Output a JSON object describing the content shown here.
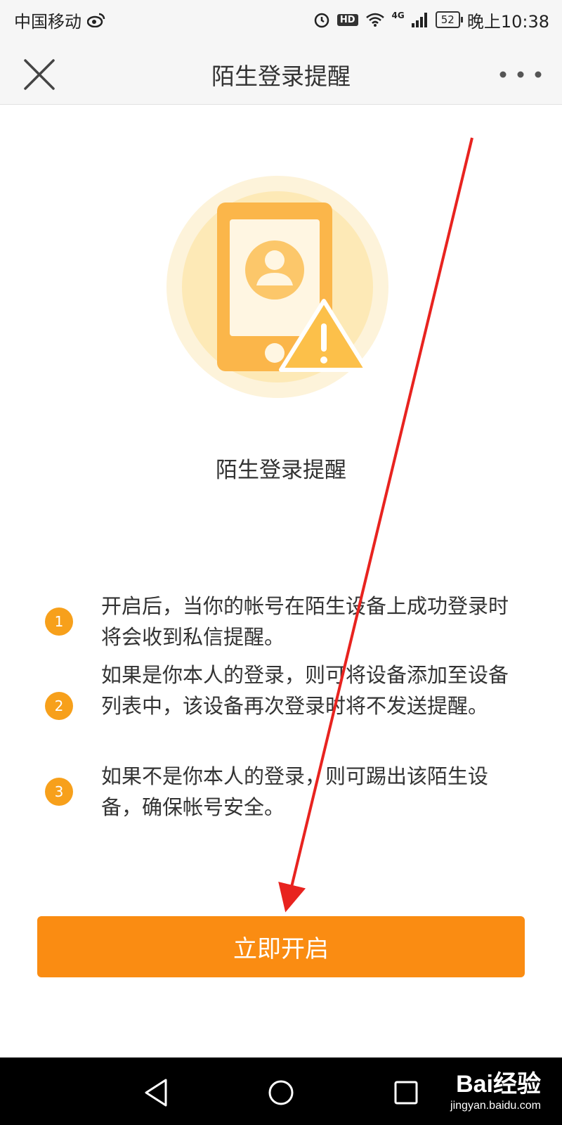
{
  "status_bar": {
    "carrier": "中国移动",
    "network": "4G",
    "battery": "52",
    "time": "晚上10:38",
    "icons": [
      "weibo-icon",
      "alarm-icon",
      "hd-icon",
      "wifi-icon",
      "signal-icon",
      "battery-icon"
    ]
  },
  "nav": {
    "title": "陌生登录提醒",
    "close_icon": "close-icon",
    "more_icon": "more-icon"
  },
  "hero": {
    "illustration": "phone-user-warning-icon",
    "title": "陌生登录提醒"
  },
  "steps": [
    {
      "number": "1",
      "text": "开启后，当你的帐号在陌生设备上成功登录时将会收到私信提醒。"
    },
    {
      "number": "2",
      "text": "如果是你本人的登录，则可将设备添加至设备列表中，该设备再次登录时将不发送提醒。"
    },
    {
      "number": "3",
      "text": "如果不是你本人的登录，则可踢出该陌生设备，确保帐号安全。"
    }
  ],
  "cta": {
    "label": "立即开启"
  },
  "system_nav": {
    "icons": [
      "back-icon",
      "home-icon",
      "recents-icon"
    ]
  },
  "watermark": {
    "brand": "Bai经验",
    "url": "jingyan.baidu.com"
  },
  "colors": {
    "accent": "#FA8C12",
    "step_badge": "#F7A01B",
    "illustration": "#FCC04A",
    "annotation_arrow": "#E8231F"
  }
}
